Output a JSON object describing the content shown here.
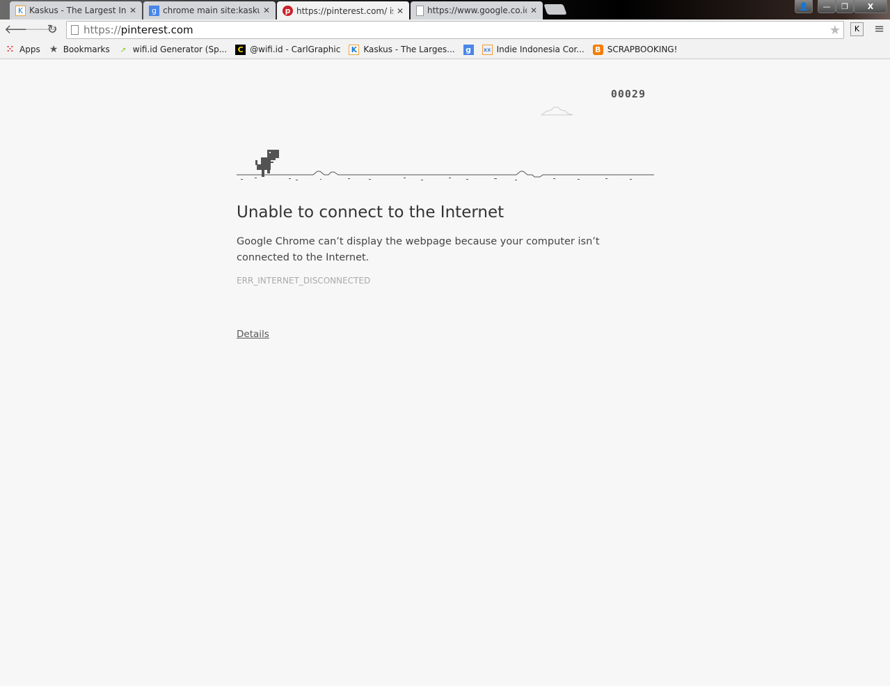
{
  "tabs": [
    {
      "title": "Kaskus - The Largest Indo",
      "icon": "kaskus-icon",
      "active": false
    },
    {
      "title": "chrome main site:kaskus.c",
      "icon": "google-icon",
      "active": false
    },
    {
      "title": "https://pinterest.com/ is n",
      "icon": "pinterest-icon",
      "active": true
    },
    {
      "title": "https://www.google.co.id/",
      "icon": "page-icon",
      "active": false
    }
  ],
  "omnibox": {
    "scheme": "https://",
    "host": "pinterest.com"
  },
  "bookmarks": [
    {
      "label": "Apps",
      "icon": "apps-grid-icon"
    },
    {
      "label": "Bookmarks",
      "icon": "star-icon"
    },
    {
      "label": "wifi.id Generator (Sp...",
      "icon": "arrow-green-icon"
    },
    {
      "label": "@wifi.id - CarlGraphic",
      "icon": "c-logo-icon"
    },
    {
      "label": "Kaskus - The Larges...",
      "icon": "kaskus-icon"
    },
    {
      "label": "",
      "icon": "google-icon"
    },
    {
      "label": "Indie Indonesia Cor...",
      "icon": "indie-icon"
    },
    {
      "label": "SCRAPBOOKING!",
      "icon": "blogger-icon"
    }
  ],
  "game": {
    "score": "00029"
  },
  "error": {
    "title": "Unable to connect to the Internet",
    "description": "Google Chrome can’t display the webpage because your computer isn’t connected to the Internet.",
    "code": "ERR_INTERNET_DISCONNECTED",
    "details_label": "Details"
  },
  "window": {
    "close": "X"
  }
}
